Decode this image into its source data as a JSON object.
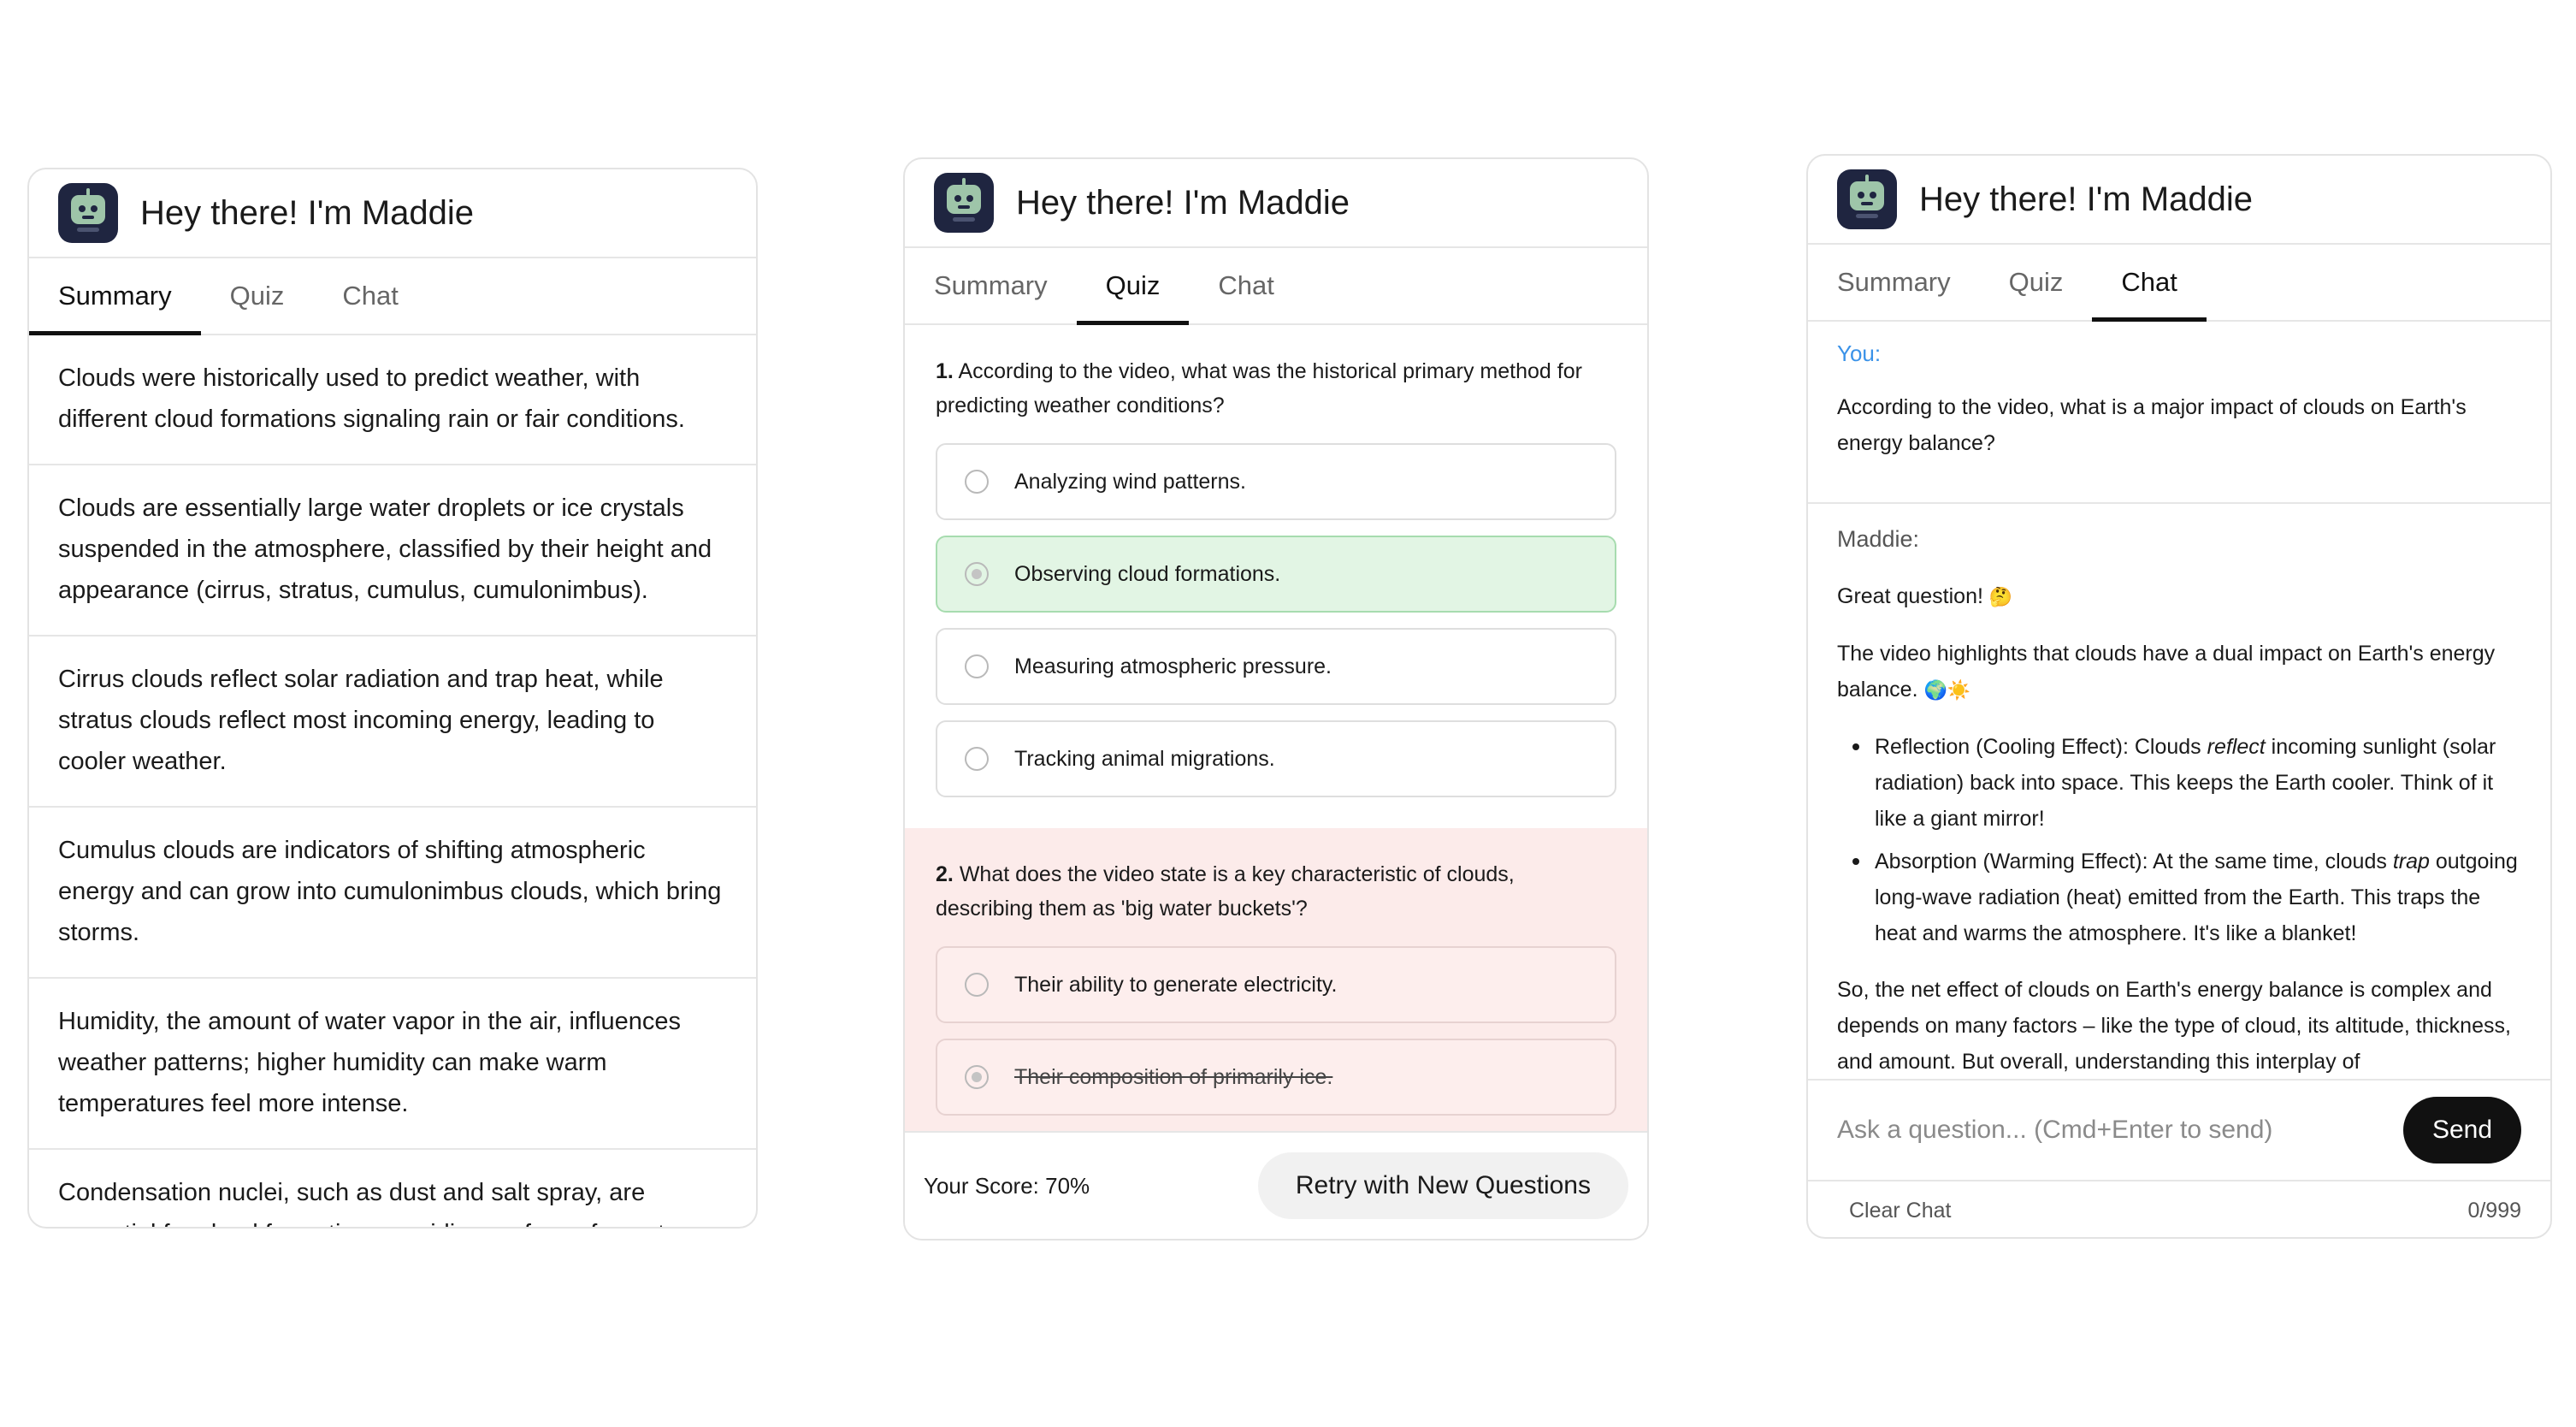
{
  "app": {
    "title": "Hey there! I'm Maddie"
  },
  "tabs": {
    "summary": "Summary",
    "quiz": "Quiz",
    "chat": "Chat"
  },
  "summary": {
    "items": [
      "Clouds were historically used to predict weather, with different cloud formations signaling rain or fair conditions.",
      "Clouds are essentially large water droplets or ice crystals suspended in the atmosphere, classified by their height and appearance (cirrus, stratus, cumulus, cumulonimbus).",
      "Cirrus clouds reflect solar radiation and trap heat, while stratus clouds reflect most incoming energy, leading to cooler weather.",
      "Cumulus clouds are indicators of shifting atmospheric energy and can grow into cumulonimbus clouds, which bring storms.",
      "Humidity, the amount of water vapor in the air, influences weather patterns; higher humidity can make warm temperatures feel more intense.",
      "Condensation nuclei, such as dust and salt spray, are essential for cloud formation, providing surfaces for water"
    ]
  },
  "quiz": {
    "questions": [
      {
        "number": "1.",
        "text": "According to the video, what was the historical primary method for predicting weather conditions?",
        "options": [
          "Analyzing wind patterns.",
          "Observing cloud formations.",
          "Measuring atmospheric pressure.",
          "Tracking animal migrations."
        ]
      },
      {
        "number": "2.",
        "text": "What does the video state is a key characteristic of clouds, describing them as 'big water buckets'?",
        "options": [
          "Their ability to generate electricity.",
          "Their composition of primarily ice."
        ]
      }
    ],
    "score": "Your Score: 70%",
    "retry": "Retry with New Questions"
  },
  "chat": {
    "you_label": "You:",
    "user_message": "According to the video, what is a major impact of clouds on Earth's energy balance?",
    "bot_label": "Maddie:",
    "bot_greeting": "Great question!",
    "bot_greeting_emoji": "🤔",
    "bot_intro": "The video highlights that clouds have a dual impact on Earth's energy balance.",
    "bot_intro_emoji": "🌍☀️",
    "bullet1_a": "Reflection (Cooling Effect): Clouds ",
    "bullet1_em": "reflect",
    "bullet1_b": " incoming sunlight (solar radiation) back into space. This keeps the Earth cooler. Think of it like a giant mirror!",
    "bullet2_a": "Absorption (Warming Effect): At the same time, clouds ",
    "bullet2_em": "trap",
    "bullet2_b": " outgoing long-wave radiation (heat) emitted from the Earth. This traps the heat and warms the atmosphere. It's like a blanket!",
    "bot_conclusion": "So, the net effect of clouds on Earth's energy balance is complex and depends on many factors – like the type of cloud, its altitude, thickness, and amount. But overall, understanding this interplay of",
    "input_placeholder": "Ask a question... (Cmd+Enter to send)",
    "send": "Send",
    "clear": "Clear Chat",
    "char_count": "0/999"
  }
}
